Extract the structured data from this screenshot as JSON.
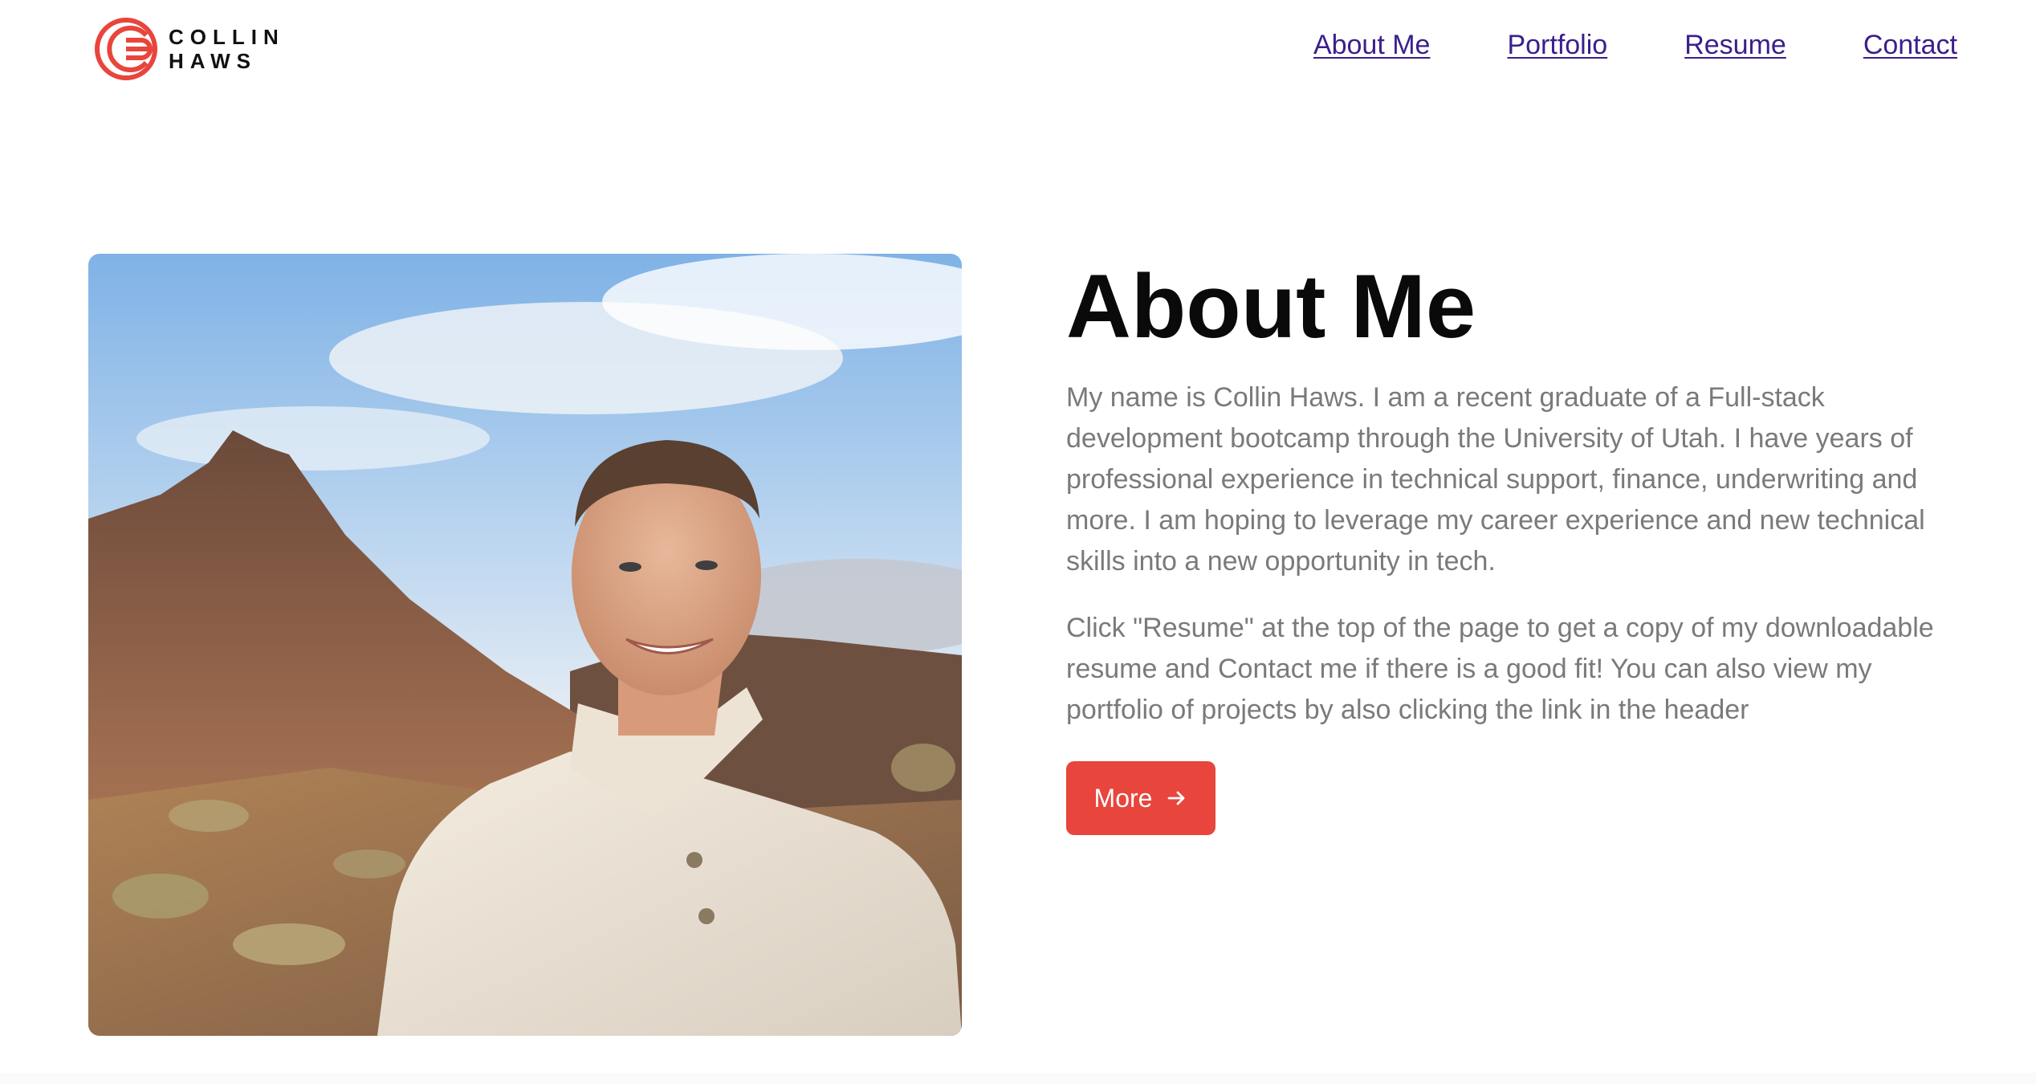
{
  "brand": {
    "line1": "COLLIN",
    "line2": "HAWS",
    "icon": "logo-c-mark-icon",
    "color": "#e8453c"
  },
  "nav": {
    "items": [
      {
        "label": "About Me"
      },
      {
        "label": "Portfolio"
      },
      {
        "label": "Resume"
      },
      {
        "label": "Contact"
      }
    ],
    "link_color": "#3b1f8c"
  },
  "hero": {
    "photo_description_icon": "portrait-photo-desert"
  },
  "about": {
    "title": "About Me",
    "paragraph1": "My name is Collin Haws. I am a recent graduate of a Full-stack development bootcamp through the University of Utah. I have years of professional experience in technical support, finance, underwriting and more. I am hoping to leverage my career experience and new technical skills into a new opportunity in tech.",
    "paragraph2": "Click \"Resume\" at the top of the page to get a copy of my downloadable resume and Contact me if there is a good fit! You can also view my portfolio of projects by also clicking the link in the header",
    "button_label": "More",
    "button_icon": "arrow-right-icon",
    "button_color": "#e8453c"
  }
}
